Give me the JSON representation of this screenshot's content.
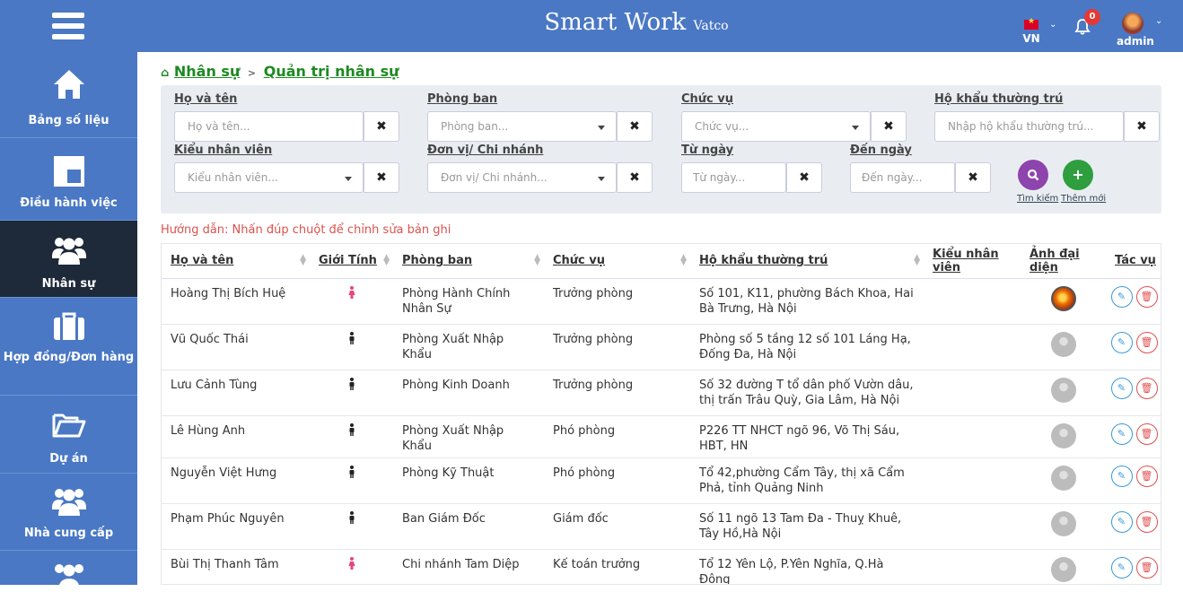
{
  "header": {
    "brand_main": "Smart Work",
    "brand_sub": "Vatco",
    "language": "VN",
    "notification_count": "0",
    "user": "admin"
  },
  "sidebar": {
    "items": [
      {
        "label": "Bảng số liệu",
        "icon": "home-icon"
      },
      {
        "label": "Điều hành việc",
        "icon": "board-icon"
      },
      {
        "label": "Nhân sự",
        "icon": "users-icon"
      },
      {
        "label": "Hợp đồng/Đơn hàng",
        "icon": "briefcase-icon"
      },
      {
        "label": "Dự án",
        "icon": "folder-icon"
      },
      {
        "label": "Nhà cung cấp",
        "icon": "users-icon"
      }
    ]
  },
  "breadcrumb": {
    "root": "Nhân sự",
    "sep": ">",
    "current": "Quản trị nhân sự"
  },
  "filters": {
    "name": {
      "label": "Họ và tên",
      "placeholder": "Họ và tên..."
    },
    "department": {
      "label": "Phòng ban",
      "placeholder": "Phòng ban..."
    },
    "position": {
      "label": "Chức vụ",
      "placeholder": "Chức vụ..."
    },
    "residence": {
      "label": "Hộ khẩu thường trú",
      "placeholder": "Nhập hộ khẩu thường trú..."
    },
    "emp_type": {
      "label": "Kiểu nhân viên",
      "placeholder": "Kiểu nhân viên..."
    },
    "branch": {
      "label": "Đơn vị/ Chi nhánh",
      "placeholder": "Đơn vị/ Chi nhánh..."
    },
    "from_date": {
      "label": "Từ ngày",
      "placeholder": "Từ ngày..."
    },
    "to_date": {
      "label": "Đến ngày",
      "placeholder": "Đến ngày..."
    },
    "clear_symbol": "✖",
    "search_label": "Tìm kiếm",
    "add_label": "Thêm mới",
    "search_color": "#8e44ad",
    "add_color": "#2e9e3e"
  },
  "hint": "Hướng dẫn: Nhấn đúp chuột để chỉnh sửa bản ghi",
  "table": {
    "columns": [
      "Họ và tên",
      "Giới Tính",
      "Phòng ban",
      "Chức vụ",
      "Hộ khẩu thường trú",
      "Kiểu nhân viên",
      "Ảnh đại diện",
      "Tác vụ"
    ],
    "rows": [
      {
        "name": "Hoàng Thị Bích Huệ",
        "gender": "female",
        "dept": "Phòng Hành Chính Nhân Sự",
        "pos": "Trưởng phòng",
        "addr": "Số 101, K11, phường Bách Khoa, Hai Bà Trưng, Hà Nội",
        "type": "",
        "avatar": "photo"
      },
      {
        "name": "Vũ Quốc Thái",
        "gender": "male",
        "dept": "Phòng Xuất Nhập Khẩu",
        "pos": "Trưởng phòng",
        "addr": "Phòng số 5 tầng 12 số 101 Láng Hạ, Đống Đa, Hà Nội",
        "type": "",
        "avatar": "placeholder"
      },
      {
        "name": "Lưu Cảnh Tùng",
        "gender": "male",
        "dept": "Phòng Kinh Doanh",
        "pos": "Trưởng phòng",
        "addr": "Số 32 đường T tổ dân phố Vườn dâu, thị trấn Trâu Quỳ, Gia Lâm, Hà Nội",
        "type": "",
        "avatar": "placeholder"
      },
      {
        "name": "Lê Hùng Anh",
        "gender": "male",
        "dept": "Phòng Xuất Nhập Khẩu",
        "pos": "Phó phòng",
        "addr": "P226 TT NHCT ngõ 96, Võ Thị Sáu, HBT, HN",
        "type": "",
        "avatar": "placeholder"
      },
      {
        "name": "Nguyễn Việt Hưng",
        "gender": "male",
        "dept": "Phòng Kỹ Thuật",
        "pos": "Phó phòng",
        "addr": "Tổ 42,phường Cẩm Tây, thị xã Cẩm Phả, tỉnh Quảng Ninh",
        "type": "",
        "avatar": "placeholder"
      },
      {
        "name": "Phạm Phúc Nguyên",
        "gender": "male",
        "dept": "Ban Giám Đốc",
        "pos": "Giám đốc",
        "addr": "Số 11 ngõ 13 Tam Đa - Thuỵ Khuê, Tây Hồ,Hà Nội",
        "type": "",
        "avatar": "placeholder"
      },
      {
        "name": "Bùi Thị Thanh Tâm",
        "gender": "female",
        "dept": "Chi nhánh Tam Diệp",
        "pos": "Kế toán trưởng",
        "addr": "Tổ 12 Yên Lộ, P.Yên Nghĩa, Q.Hà Đông",
        "type": "",
        "avatar": "placeholder"
      }
    ],
    "female_color": "#e8457a",
    "male_color": "#222222"
  }
}
